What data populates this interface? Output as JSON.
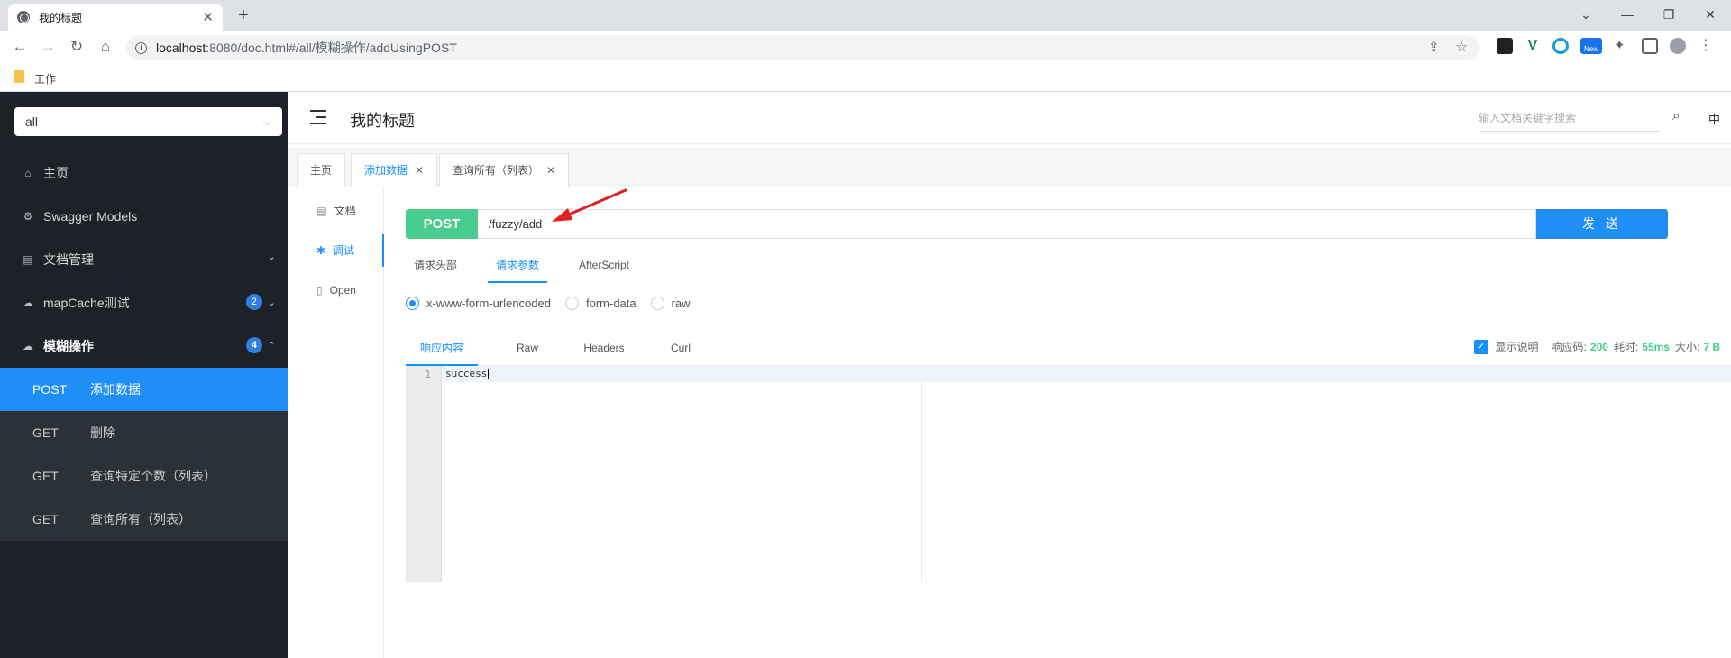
{
  "browser": {
    "tab_title": "我的标题",
    "tab_close": "✕",
    "new_tab": "+",
    "url_host": "localhost",
    "url_path": ":8080/doc.html#/all/模糊操作/addUsingPOST",
    "bookmark_label": "工作",
    "new_badge": "New"
  },
  "sidebar": {
    "select_value": "all",
    "items": [
      {
        "label": "主页",
        "icon": "home-icon"
      },
      {
        "label": "Swagger Models",
        "icon": "gear-icon"
      },
      {
        "label": "文档管理",
        "icon": "doc-icon"
      },
      {
        "label": "mapCache测试",
        "icon": "cloud-icon",
        "badge": "2"
      },
      {
        "label": "模糊操作",
        "icon": "cloud-icon",
        "badge": "4"
      }
    ],
    "endpoints": [
      {
        "method": "POST",
        "label": "添加数据"
      },
      {
        "method": "GET",
        "label": "删除"
      },
      {
        "method": "GET",
        "label": "查询特定个数（列表）"
      },
      {
        "method": "GET",
        "label": "查询所有（列表）"
      }
    ]
  },
  "header": {
    "title": "我的标题",
    "search_placeholder": "输入文档关键字搜索",
    "lang": "中"
  },
  "page_tabs": [
    {
      "label": "主页"
    },
    {
      "label": "添加数据"
    },
    {
      "label": "查询所有（列表）"
    }
  ],
  "left_nav": [
    {
      "label": "文档"
    },
    {
      "label": "调试"
    },
    {
      "label": "Open"
    }
  ],
  "request": {
    "method": "POST",
    "url": "/fuzzy/add",
    "send_label": "发 送",
    "tabs": [
      "请求头部",
      "请求参数",
      "AfterScript"
    ],
    "body_types": [
      "x-www-form-urlencoded",
      "form-data",
      "raw"
    ]
  },
  "response": {
    "tabs": [
      "响应内容",
      "Raw",
      "Headers",
      "Curl"
    ],
    "show_desc": "显示说明",
    "code_label": "响应码:",
    "code_value": "200",
    "time_label": "耗时:",
    "time_value": "55ms",
    "size_label": "大小:",
    "size_value": "7 B",
    "line_number": "1",
    "body": "success"
  },
  "colors": {
    "accent": "#1890ff",
    "post_green": "#49cc90",
    "sidebar_bg": "#1c2228",
    "arrow_red": "#e02020"
  }
}
